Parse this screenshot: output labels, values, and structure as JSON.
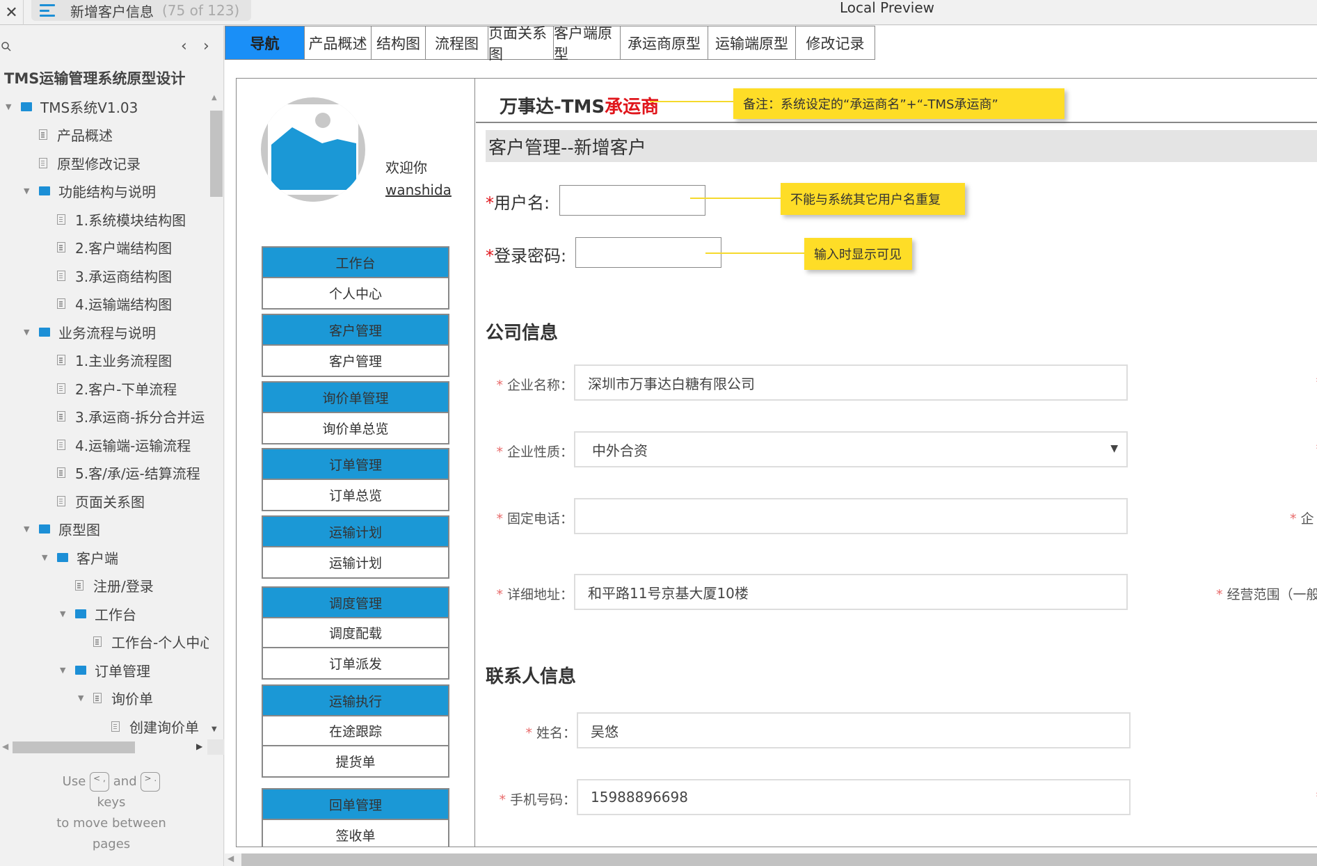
{
  "topbar": {
    "close_icon": "close-icon",
    "page_title": "新增客户信息",
    "page_count": "(75 of 123)",
    "app_title": "Local Preview"
  },
  "sidebar": {
    "project_title": "TMS运输管理系统原型设计",
    "prev": "‹",
    "next": "›",
    "tree": [
      {
        "label": "TMS系统V1.03",
        "type": "folder",
        "level": 0,
        "expanded": true
      },
      {
        "label": "产品概述",
        "type": "page",
        "level": 1
      },
      {
        "label": "原型修改记录",
        "type": "page",
        "level": 1
      },
      {
        "label": "功能结构与说明",
        "type": "folder",
        "level": 1,
        "expanded": true
      },
      {
        "label": "1.系统模块结构图",
        "type": "page",
        "level": 2
      },
      {
        "label": "2.客户端结构图",
        "type": "page",
        "level": 2
      },
      {
        "label": "3.承运商结构图",
        "type": "page",
        "level": 2
      },
      {
        "label": "4.运输端结构图",
        "type": "page",
        "level": 2
      },
      {
        "label": "业务流程与说明",
        "type": "folder",
        "level": 1,
        "expanded": true
      },
      {
        "label": "1.主业务流程图",
        "type": "page",
        "level": 2
      },
      {
        "label": "2.客户-下单流程",
        "type": "page",
        "level": 2
      },
      {
        "label": "3.承运商-拆分合并运",
        "type": "page",
        "level": 2
      },
      {
        "label": "4.运输端-运输流程",
        "type": "page",
        "level": 2
      },
      {
        "label": "5.客/承/运-结算流程",
        "type": "page",
        "level": 2
      },
      {
        "label": "页面关系图",
        "type": "page",
        "level": 2
      },
      {
        "label": "原型图",
        "type": "folder",
        "level": 1,
        "expanded": true
      },
      {
        "label": "客户端",
        "type": "folder",
        "level": 2,
        "expanded": true
      },
      {
        "label": "注册/登录",
        "type": "page",
        "level": 3
      },
      {
        "label": "工作台",
        "type": "folder",
        "level": 3,
        "expanded": true
      },
      {
        "label": "工作台-个人中心",
        "type": "page",
        "level": 4
      },
      {
        "label": "订单管理",
        "type": "folder",
        "level": 3,
        "expanded": true
      },
      {
        "label": "询价单",
        "type": "page",
        "level": 4,
        "expanded": true
      },
      {
        "label": "创建询价单",
        "type": "page",
        "level": 5
      }
    ],
    "hint": {
      "use": "Use",
      "key_prev": "< ,",
      "and": "and",
      "key_next": "> .",
      "keys": "keys",
      "line2": "to move between",
      "line3": "pages"
    }
  },
  "tabs": [
    {
      "label": "导航",
      "active": true
    },
    {
      "label": "产品概述"
    },
    {
      "label": "结构图"
    },
    {
      "label": "流程图"
    },
    {
      "label": "页面关系图"
    },
    {
      "label": "客户端原型"
    },
    {
      "label": "承运商原型"
    },
    {
      "label": "运输端原型"
    },
    {
      "label": "修改记录"
    }
  ],
  "profile": {
    "welcome": "欢迎你",
    "username": "wanshida"
  },
  "menu": [
    {
      "head": "工作台",
      "items": [
        "个人中心"
      ]
    },
    {
      "head": "客户管理",
      "items": [
        "客户管理"
      ]
    },
    {
      "head": "询价单管理",
      "items": [
        "询价单总览"
      ]
    },
    {
      "head": "订单管理",
      "items": [
        "订单总览"
      ]
    },
    {
      "head": "运输计划",
      "items": [
        "运输计划"
      ]
    },
    {
      "head": "调度管理",
      "items": [
        "调度配载",
        "订单派发"
      ]
    },
    {
      "head": "运输执行",
      "items": [
        "在途跟踪",
        "提货单"
      ]
    },
    {
      "head": "回单管理",
      "items": [
        "签收单"
      ]
    }
  ],
  "header": {
    "brand_prefix": "万事达-TMS",
    "brand_suffix": "承运商",
    "brand_note": "备注：系统设定的“承运商名”+“-TMS承运商”",
    "section_title": "客户管理--新增客户"
  },
  "account": {
    "required_mark": "*",
    "username_label": "用户名:",
    "username_value": "",
    "username_note": "不能与系统其它用户名重复",
    "password_label": "登录密码:",
    "password_value": "",
    "password_note": "输入时显示可见"
  },
  "company": {
    "title": "公司信息",
    "fields": {
      "name": {
        "label": "企业名称：",
        "value": "深圳市万事达白糖有限公司"
      },
      "type": {
        "label": "企业性质：",
        "value": "中外合资"
      },
      "phone": {
        "label": "固定电话：",
        "value": ""
      },
      "address": {
        "label": "详细地址：",
        "value": "和平路11号京基大厦10楼"
      }
    },
    "right_labels": {
      "row3": "企",
      "row4": "经营范围（一般经"
    }
  },
  "contact": {
    "title": "联系人信息",
    "fields": {
      "name": {
        "label": "姓名：",
        "value": "吴悠"
      },
      "mobile": {
        "label": "手机号码：",
        "value": "15988896698"
      }
    }
  },
  "colors": {
    "accent": "#1a8ff7",
    "menu_head": "#1b98d6",
    "note": "#fedd27",
    "required": "#e0151b",
    "folder": "#1c8fd6"
  }
}
